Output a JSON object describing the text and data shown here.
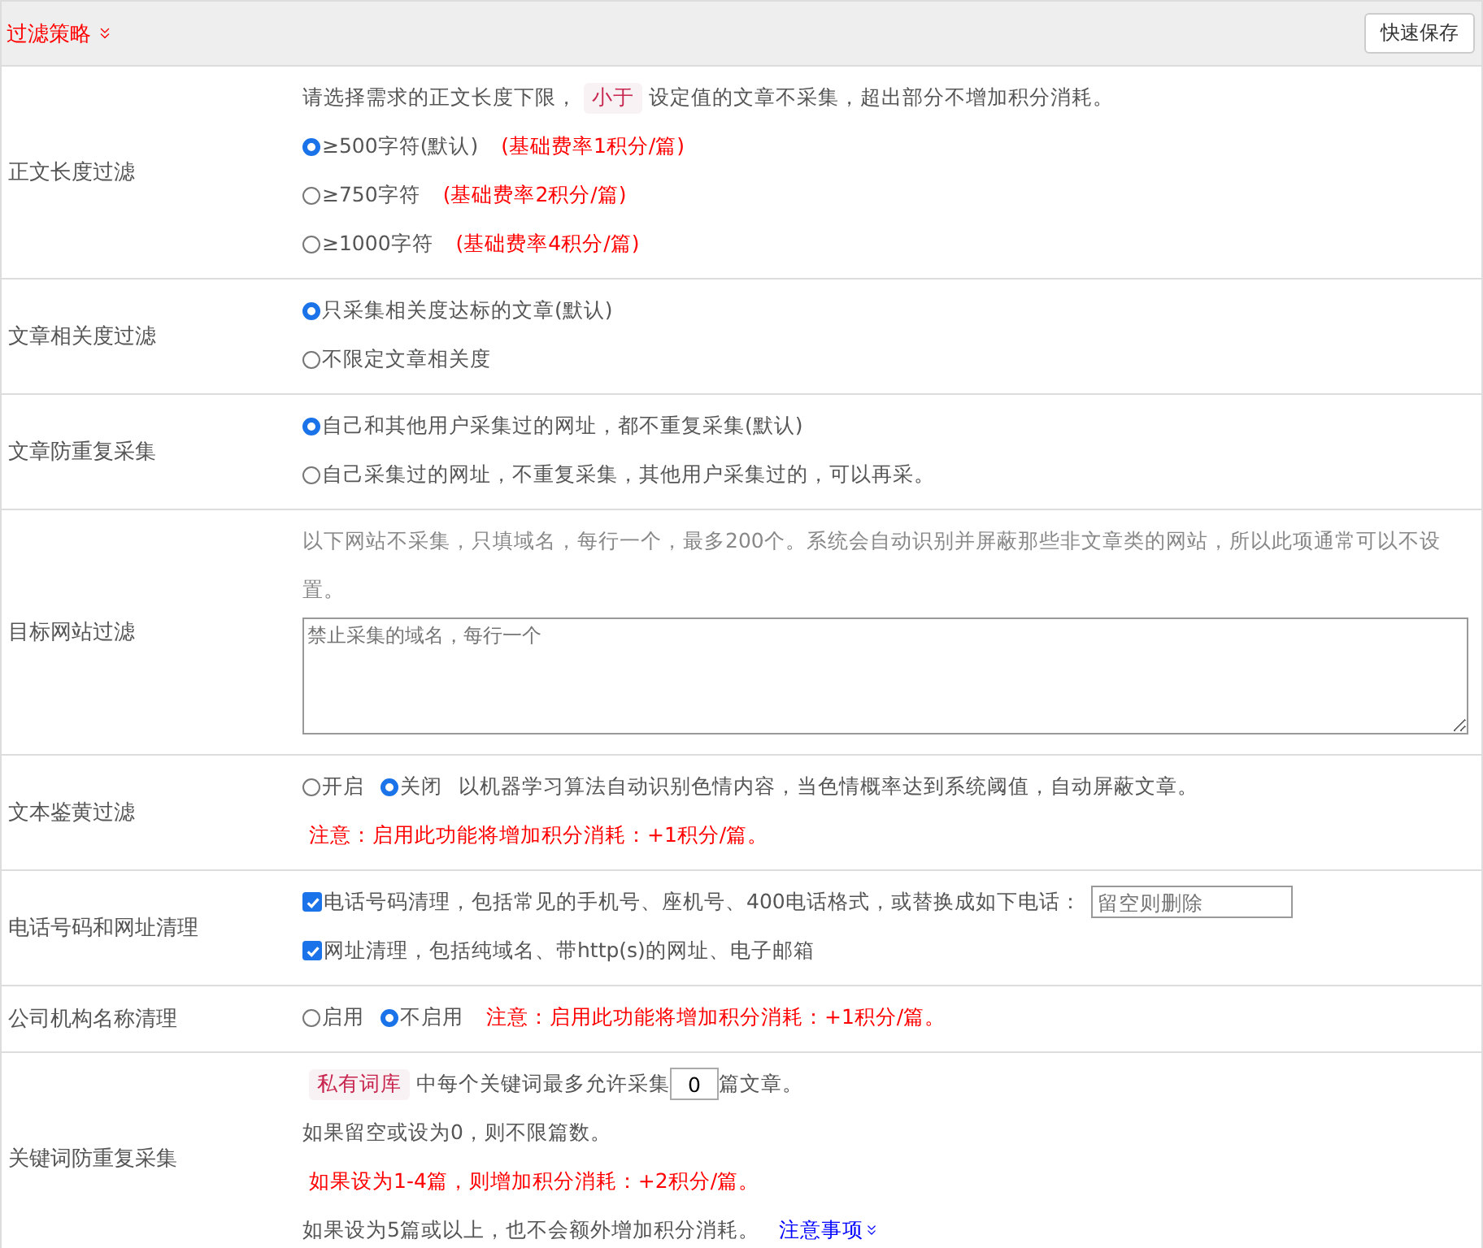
{
  "header": {
    "title": "过滤策略",
    "button": "快速保存"
  },
  "rows": [
    {
      "label": "正文长度过滤",
      "lines": [
        {
          "parts": [
            {
              "kind": "text",
              "text": "请选择需求的正文长度下限，"
            },
            {
              "kind": "tag",
              "text": "小于"
            },
            {
              "kind": "text",
              "text": "设定值的文章不采集，超出部分不增加积分消耗。"
            }
          ]
        },
        {
          "parts": [
            {
              "kind": "radio",
              "text": "≥500字符(默认)",
              "selected": true
            },
            {
              "kind": "red",
              "text": "(基础费率1积分/篇)"
            }
          ]
        },
        {
          "parts": [
            {
              "kind": "radio",
              "text": "≥750字符",
              "selected": false
            },
            {
              "kind": "red",
              "text": "(基础费率2积分/篇)"
            }
          ]
        },
        {
          "parts": [
            {
              "kind": "radio",
              "text": "≥1000字符",
              "selected": false
            },
            {
              "kind": "red",
              "text": "(基础费率4积分/篇)"
            }
          ]
        }
      ]
    },
    {
      "label": "文章相关度过滤",
      "lines": [
        {
          "parts": [
            {
              "kind": "radio",
              "text": "只采集相关度达标的文章(默认)",
              "selected": true
            }
          ]
        },
        {
          "parts": [
            {
              "kind": "radio",
              "text": "不限定文章相关度",
              "selected": false
            }
          ]
        }
      ]
    },
    {
      "label": "文章防重复采集",
      "lines": [
        {
          "parts": [
            {
              "kind": "radio",
              "text": "自己和其他用户采集过的网址，都不重复采集(默认)",
              "selected": true
            }
          ]
        },
        {
          "parts": [
            {
              "kind": "radio",
              "text": "自己采集过的网址，不重复采集，其他用户采集过的，可以再采。",
              "selected": false
            }
          ]
        }
      ]
    },
    {
      "label": "目标网站过滤",
      "lines": [
        {
          "parts": [
            {
              "kind": "hint",
              "text": "以下网站不采集，只填域名，每行一个，最多200个。系统会自动识别并屏蔽那些非文章类的网站，所以此项通常可以不设置。"
            }
          ]
        },
        {
          "parts": [
            {
              "kind": "textarea",
              "placeholder": "禁止采集的域名，每行一个"
            }
          ]
        }
      ]
    },
    {
      "label": "文本鉴黄过滤",
      "lines": [
        {
          "parts": [
            {
              "kind": "radio",
              "text": "开启",
              "selected": false
            },
            {
              "kind": "radio",
              "text": "关闭",
              "selected": true
            },
            {
              "kind": "text",
              "text": "以机器学习算法自动识别色情内容，当色情概率达到系统阈值，自动屏蔽文章。"
            }
          ]
        },
        {
          "parts": [
            {
              "kind": "red",
              "text": "注意：启用此功能将增加积分消耗：+1积分/篇。"
            }
          ]
        }
      ]
    },
    {
      "label": "电话号码和网址清理",
      "lines": [
        {
          "parts": [
            {
              "kind": "checkbox",
              "text": "电话号码清理，包括常见的手机号、座机号、400电话格式，或替换成如下电话：",
              "checked": true
            },
            {
              "kind": "input",
              "placeholder": "留空则删除"
            }
          ]
        },
        {
          "parts": [
            {
              "kind": "checkbox",
              "text": "网址清理，包括纯域名、带http(s)的网址、电子邮箱",
              "checked": true
            }
          ]
        }
      ]
    },
    {
      "label": "公司机构名称清理",
      "lines": [
        {
          "parts": [
            {
              "kind": "radio",
              "text": "启用",
              "selected": false
            },
            {
              "kind": "radio",
              "text": "不启用",
              "selected": true
            },
            {
              "kind": "red",
              "text": "注意：启用此功能将增加积分消耗：+1积分/篇。"
            }
          ]
        }
      ]
    },
    {
      "label": "关键词防重复采集",
      "lines": [
        {
          "parts": [
            {
              "kind": "tag",
              "text": "私有词库"
            },
            {
              "kind": "text",
              "text": "中每个关键词最多允许采集"
            },
            {
              "kind": "smallinput",
              "value": "0"
            },
            {
              "kind": "text",
              "text": "篇文章。"
            }
          ]
        },
        {
          "parts": [
            {
              "kind": "text",
              "text": "如果留空或设为0，则不限篇数。"
            }
          ]
        },
        {
          "parts": [
            {
              "kind": "red",
              "text": "如果设为1-4篇，则增加积分消耗：+2积分/篇。"
            }
          ]
        },
        {
          "parts": [
            {
              "kind": "text",
              "text": "如果设为5篇或以上，也不会额外增加积分消耗。"
            },
            {
              "kind": "link",
              "text": "注意事项"
            }
          ]
        }
      ]
    }
  ]
}
